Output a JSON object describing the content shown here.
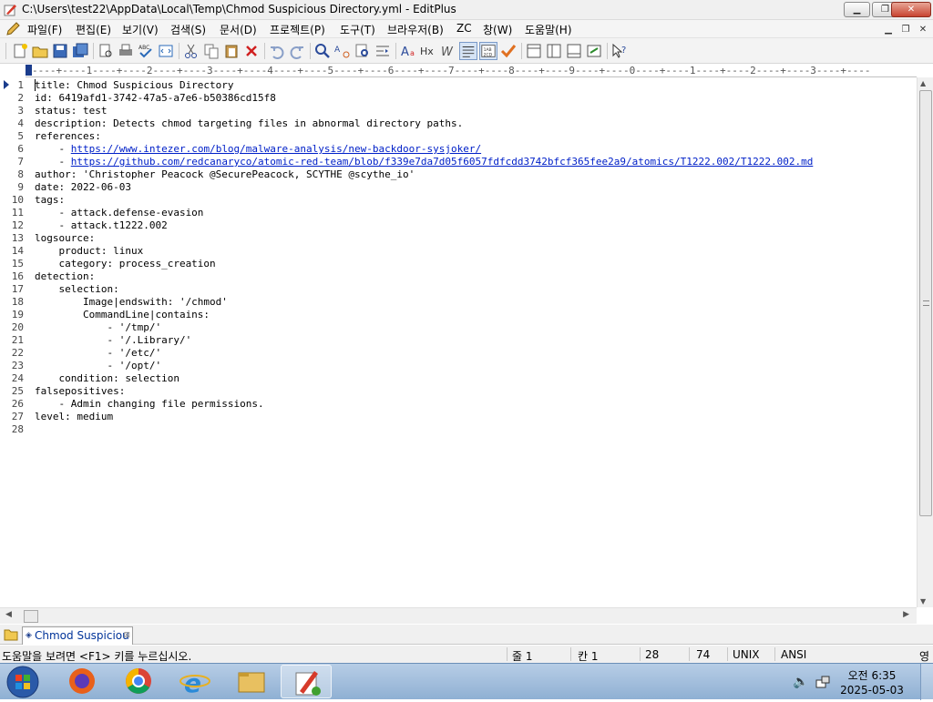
{
  "window": {
    "title": "C:\\Users\\test22\\AppData\\Local\\Temp\\Chmod Suspicious Directory.yml - EditPlus",
    "minimize": "▁",
    "restore": "❐",
    "close": "✕"
  },
  "menu": {
    "items": [
      "파일(F)",
      "편집(E)",
      "보기(V)",
      "검색(S)",
      "문서(D)",
      "프로젝트(P)",
      "도구(T)",
      "브라우저(B)",
      "ZC",
      "창(W)",
      "도움말(H)"
    ]
  },
  "ruler": {
    "text": "----+----1----+----2----+----3----+----4----+----5----+----6----+----7----+----8----+----9----+----0----+----1----+----2----+----3----+----"
  },
  "editor": {
    "lines": [
      "title: Chmod Suspicious Directory",
      "id: 6419afd1-3742-47a5-a7e6-b50386cd15f8",
      "status: test",
      "description: Detects chmod targeting files in abnormal directory paths.",
      "references:",
      "    - https://www.intezer.com/blog/malware-analysis/new-backdoor-sysjoker/",
      "    - https://github.com/redcanaryco/atomic-red-team/blob/f339e7da7d05f6057fdfcdd3742bfcf365fee2a9/atomics/T1222.002/T1222.002.md",
      "author: 'Christopher Peacock @SecurePeacock, SCYTHE @scythe_io'",
      "date: 2022-06-03",
      "tags:",
      "    - attack.defense-evasion",
      "    - attack.t1222.002",
      "logsource:",
      "    product: linux",
      "    category: process_creation",
      "detection:",
      "    selection:",
      "        Image|endswith: '/chmod'",
      "        CommandLine|contains:",
      "            - '/tmp/'",
      "            - '/.Library/'",
      "            - '/etc/'",
      "            - '/opt/'",
      "    condition: selection",
      "falsepositives:",
      "    - Admin changing file permissions.",
      "level: medium",
      ""
    ],
    "link_prefix": "    - ",
    "link_lines": [
      6,
      7
    ],
    "line_numbers": [
      "1",
      "2",
      "3",
      "4",
      "5",
      "6",
      "7",
      "8",
      "9",
      "10",
      "11",
      "12",
      "13",
      "14",
      "15",
      "16",
      "17",
      "18",
      "19",
      "20",
      "21",
      "22",
      "23",
      "24",
      "25",
      "26",
      "27",
      "28"
    ]
  },
  "tab": {
    "label": "Chmod Suspiciou"
  },
  "status": {
    "help": "도움말을 보려면 <F1> 키를 누르십시오.",
    "line": "줄 1",
    "col": "칸 1",
    "total_lines": "28",
    "chars": "74",
    "eol": "UNIX",
    "encoding": "ANSI",
    "ime": "영"
  },
  "taskbar": {
    "time": "오전 6:35",
    "date": "2025-05-03"
  },
  "colors": {
    "link": "#0020c8",
    "accent": "#1a3c8c"
  }
}
